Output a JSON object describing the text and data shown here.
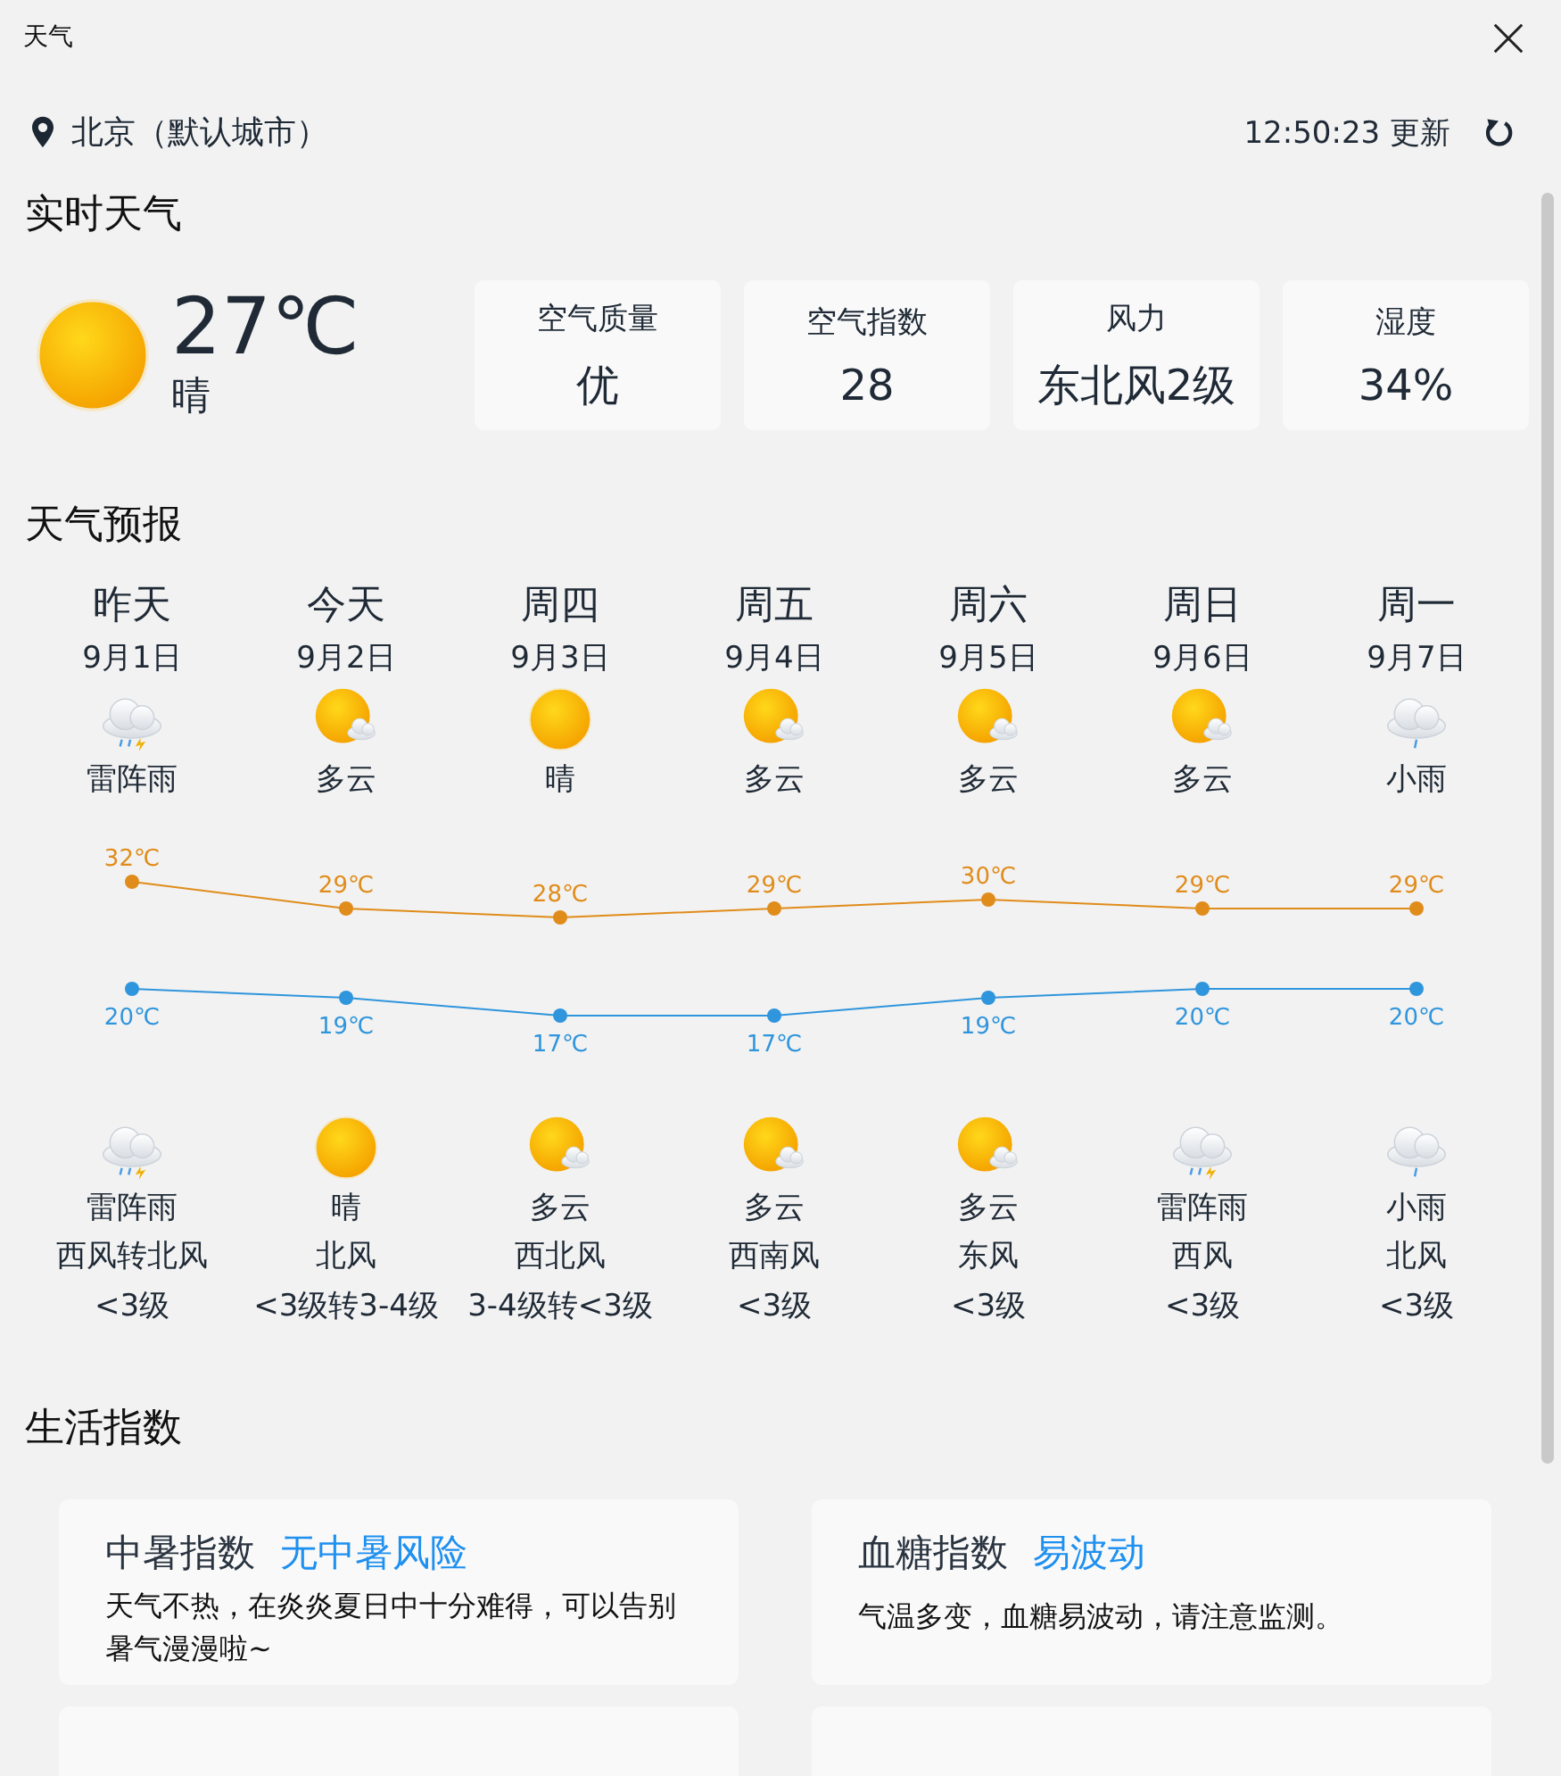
{
  "window": {
    "title": "天气"
  },
  "location": {
    "city": "北京（默认城市）",
    "updated": "12:50:23 更新"
  },
  "current": {
    "heading": "实时天气",
    "kind": "sun",
    "temperature": "27℃",
    "condition": "晴",
    "stats": [
      {
        "label": "空气质量",
        "value": "优"
      },
      {
        "label": "空气指数",
        "value": "28"
      },
      {
        "label": "风力",
        "value": "东北风2级"
      },
      {
        "label": "湿度",
        "value": "34%"
      }
    ]
  },
  "forecast": {
    "heading": "天气预报",
    "days": [
      {
        "name": "昨天",
        "date": "9月1日",
        "day": {
          "kind": "thunder",
          "text": "雷阵雨"
        },
        "night": {
          "kind": "thunder",
          "text": "雷阵雨"
        },
        "wind": "西风转北风",
        "wind_level": "<3级"
      },
      {
        "name": "今天",
        "date": "9月2日",
        "day": {
          "kind": "cloudy",
          "text": "多云"
        },
        "night": {
          "kind": "sun",
          "text": "晴"
        },
        "wind": "北风",
        "wind_level": "<3级转3-4级"
      },
      {
        "name": "周四",
        "date": "9月3日",
        "day": {
          "kind": "sun",
          "text": "晴"
        },
        "night": {
          "kind": "cloudy",
          "text": "多云"
        },
        "wind": "西北风",
        "wind_level": "3-4级转<3级"
      },
      {
        "name": "周五",
        "date": "9月4日",
        "day": {
          "kind": "cloudy",
          "text": "多云"
        },
        "night": {
          "kind": "cloudy",
          "text": "多云"
        },
        "wind": "西南风",
        "wind_level": "<3级"
      },
      {
        "name": "周六",
        "date": "9月5日",
        "day": {
          "kind": "cloudy",
          "text": "多云"
        },
        "night": {
          "kind": "cloudy",
          "text": "多云"
        },
        "wind": "东风",
        "wind_level": "<3级"
      },
      {
        "name": "周日",
        "date": "9月6日",
        "day": {
          "kind": "cloudy",
          "text": "多云"
        },
        "night": {
          "kind": "thunder",
          "text": "雷阵雨"
        },
        "wind": "西风",
        "wind_level": "<3级"
      },
      {
        "name": "周一",
        "date": "9月7日",
        "day": {
          "kind": "rain",
          "text": "小雨"
        },
        "night": {
          "kind": "rain",
          "text": "小雨"
        },
        "wind": "北风",
        "wind_level": "<3级"
      }
    ],
    "chart_data": {
      "type": "line",
      "data_labels": true,
      "series": [
        {
          "color": "#e08c1a",
          "marker": "circle",
          "values": [
            32,
            29,
            28,
            29,
            30,
            29,
            29
          ],
          "value_labels": [
            "32℃",
            "29℃",
            "28℃",
            "29℃",
            "30℃",
            "29℃",
            "29℃"
          ]
        },
        {
          "color": "#2f95dc",
          "marker": "circle",
          "values": [
            20,
            19,
            17,
            17,
            19,
            20,
            20
          ],
          "value_labels": [
            "20℃",
            "19℃",
            "17℃",
            "17℃",
            "19℃",
            "20℃",
            "20℃"
          ]
        }
      ]
    }
  },
  "life": {
    "heading": "生活指数",
    "cards": [
      {
        "name": "中暑指数",
        "value": "无中暑风险",
        "text": "天气不热，在炎炎夏日中十分难得，可以告别暑气漫漫啦~"
      },
      {
        "name": "血糖指数",
        "value": "易波动",
        "text": "气温多变，血糖易波动，请注意监测。"
      }
    ]
  }
}
